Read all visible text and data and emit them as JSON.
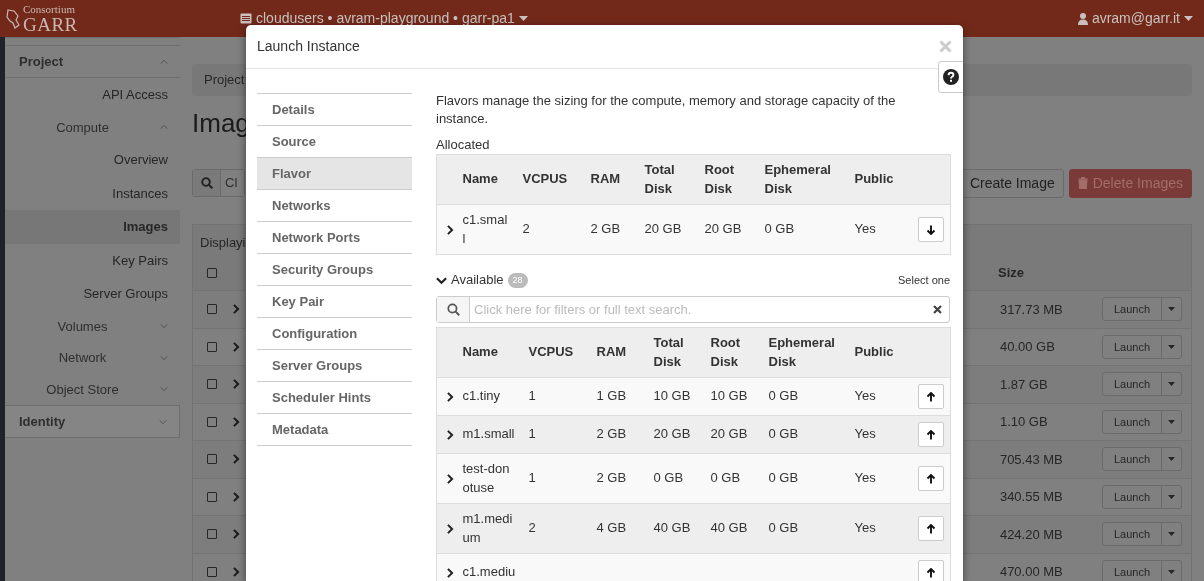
{
  "navbar": {
    "logo": {
      "line_1": "Consortium",
      "line_2": "GARR"
    },
    "project_selector": "cloudusers • avram-playground • garr-pa1",
    "user_menu": "avram@garr.it"
  },
  "sidebar": {
    "sections": [
      {
        "label": "Project",
        "expanded": true,
        "items": [
          {
            "label": "API Access",
            "selected": false
          },
          {
            "label": "Compute",
            "selected": false,
            "expanded": true,
            "children": [
              {
                "label": "Overview",
                "selected": false
              },
              {
                "label": "Instances",
                "selected": false
              },
              {
                "label": "Images",
                "selected": true
              },
              {
                "label": "Key Pairs",
                "selected": false
              },
              {
                "label": "Server Groups",
                "selected": false
              }
            ]
          },
          {
            "label": "Volumes",
            "selected": false,
            "expanded": false
          },
          {
            "label": "Network",
            "selected": false,
            "expanded": false
          },
          {
            "label": "Object Store",
            "selected": false,
            "expanded": false
          }
        ]
      },
      {
        "label": "Identity",
        "expanded": false
      }
    ]
  },
  "page": {
    "breadcrumb": "Project",
    "heading": "Imag",
    "search": {
      "placeholder": "Cl"
    },
    "buttons": [
      {
        "kind": "default",
        "label": "Create Image"
      },
      {
        "kind": "danger",
        "label": "Delete Images"
      }
    ],
    "table": {
      "caption": "Displayi",
      "select_all_checked": false,
      "columns": [
        "Size"
      ],
      "rows": [
        {
          "checked": false,
          "size": "317.73 MB",
          "action": "Launch"
        },
        {
          "checked": false,
          "size": "40.00 GB",
          "action": "Launch"
        },
        {
          "checked": false,
          "size": "1.87 GB",
          "action": "Launch"
        },
        {
          "checked": false,
          "size": "1.10 GB",
          "action": "Launch"
        },
        {
          "checked": false,
          "size": "705.43 MB",
          "action": "Launch"
        },
        {
          "checked": false,
          "size": "340.55 MB",
          "action": "Launch"
        },
        {
          "checked": false,
          "size": "424.20 MB",
          "action": "Launch"
        },
        {
          "checked": false,
          "size": "470.00 MB",
          "action": "Launch"
        }
      ]
    }
  },
  "modal": {
    "title": "Launch Instance",
    "steps": [
      {
        "label": "Details",
        "selected": false
      },
      {
        "label": "Source",
        "selected": false
      },
      {
        "label": "Flavor",
        "selected": true
      },
      {
        "label": "Networks",
        "selected": false
      },
      {
        "label": "Network Ports",
        "selected": false
      },
      {
        "label": "Security Groups",
        "selected": false
      },
      {
        "label": "Key Pair",
        "selected": false
      },
      {
        "label": "Configuration",
        "selected": false
      },
      {
        "label": "Server Groups",
        "selected": false
      },
      {
        "label": "Scheduler Hints",
        "selected": false
      },
      {
        "label": "Metadata",
        "selected": false
      }
    ],
    "description": "Flavors manage the sizing for the compute, memory and storage capacity of the instance.",
    "allocated": {
      "label": "Allocated",
      "columns": [
        "Name",
        "VCPUS",
        "RAM",
        "Total Disk",
        "Root Disk",
        "Ephemeral Disk",
        "Public"
      ],
      "rows": [
        {
          "name": "c1.small",
          "vcpus": "2",
          "ram": "2 GB",
          "total_disk": "20 GB",
          "root_disk": "20 GB",
          "ephemeral_disk": "0 GB",
          "public": "Yes"
        }
      ]
    },
    "available": {
      "label": "Available",
      "expanded": true,
      "count": "28",
      "hint": "Select one",
      "search": {
        "placeholder": "Click here for filters or full text search."
      },
      "columns": [
        "Name",
        "VCPUS",
        "RAM",
        "Total Disk",
        "Root Disk",
        "Ephemeral Disk",
        "Public"
      ],
      "rows": [
        {
          "name": "c1.tiny",
          "vcpus": "1",
          "ram": "1 GB",
          "total_disk": "10 GB",
          "root_disk": "10 GB",
          "ephemeral_disk": "0 GB",
          "public": "Yes"
        },
        {
          "name": "m1.small",
          "vcpus": "1",
          "ram": "2 GB",
          "total_disk": "20 GB",
          "root_disk": "20 GB",
          "ephemeral_disk": "0 GB",
          "public": "Yes"
        },
        {
          "name": "test-donotuse",
          "vcpus": "1",
          "ram": "2 GB",
          "total_disk": "0 GB",
          "root_disk": "0 GB",
          "ephemeral_disk": "0 GB",
          "public": "Yes"
        },
        {
          "name": "m1.medium",
          "vcpus": "2",
          "ram": "4 GB",
          "total_disk": "40 GB",
          "root_disk": "40 GB",
          "ephemeral_disk": "0 GB",
          "public": "Yes"
        },
        {
          "name": "c1.mediu"
        }
      ]
    }
  }
}
